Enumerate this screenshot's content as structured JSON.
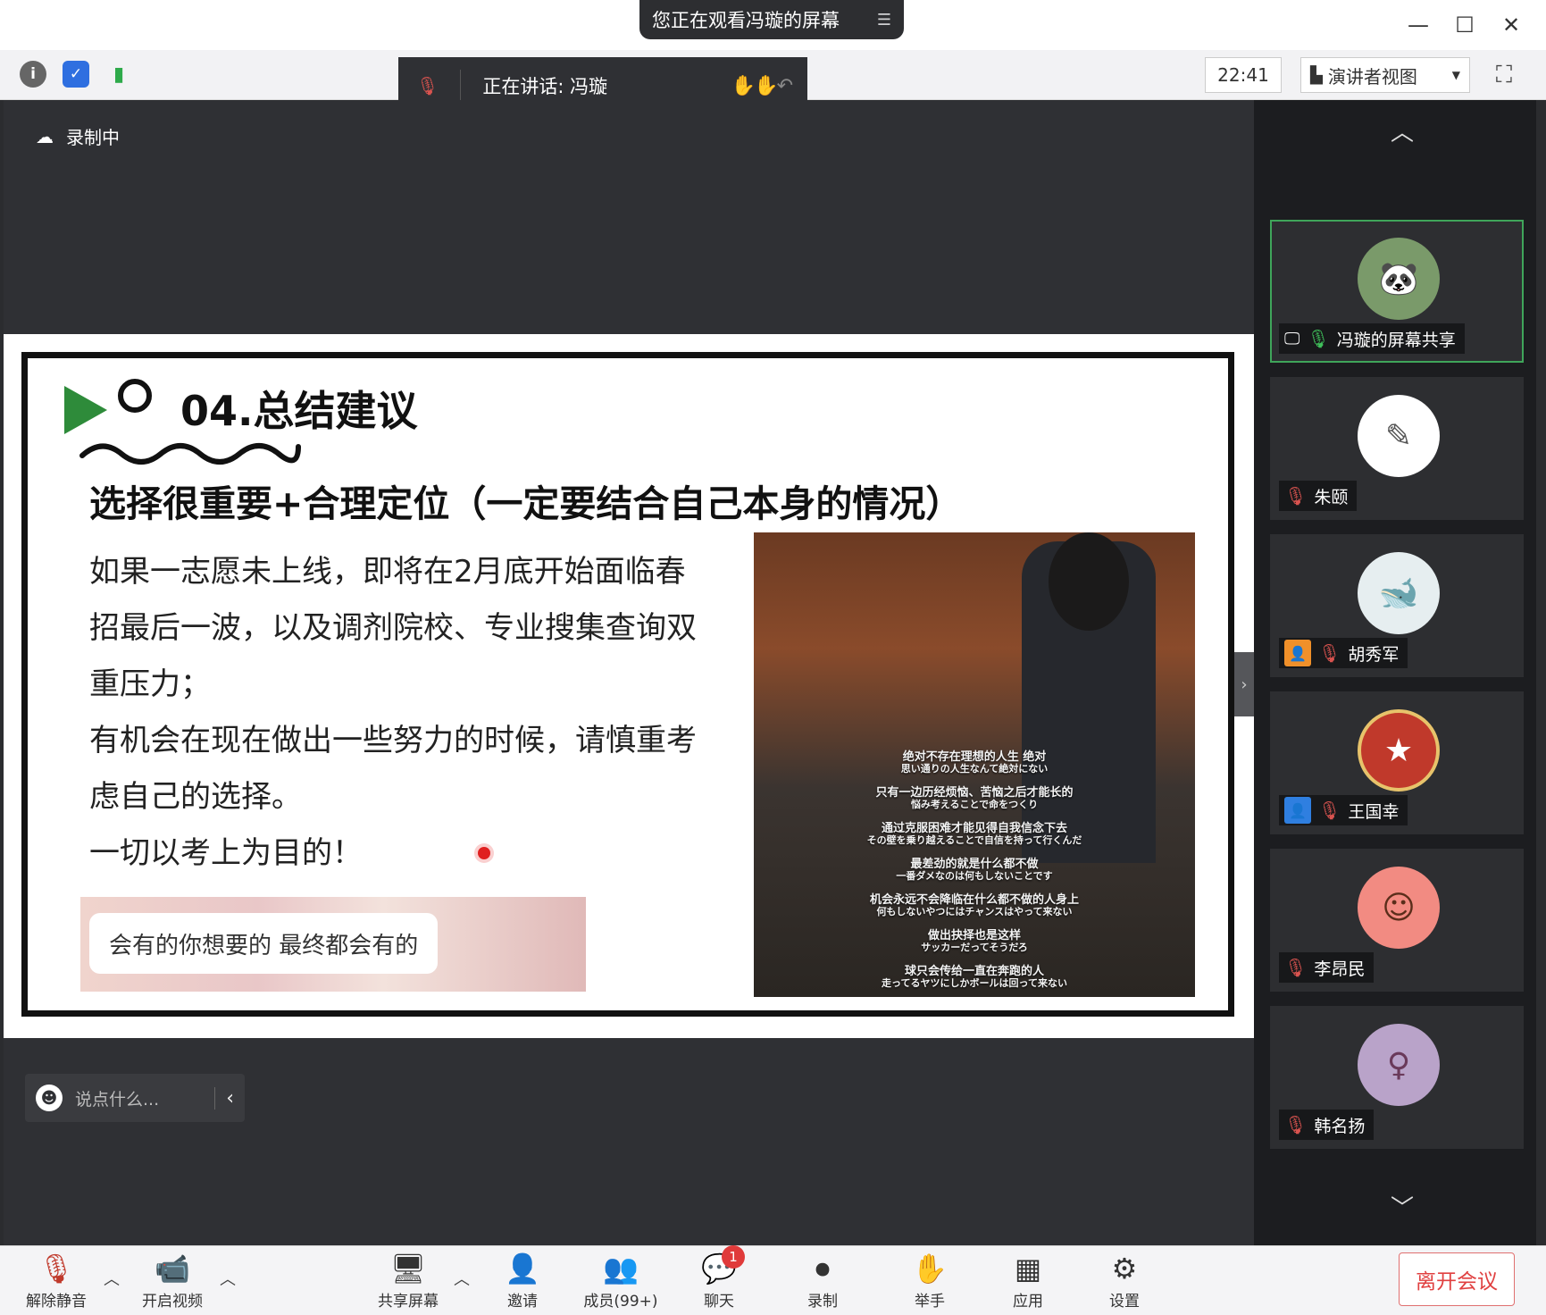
{
  "window": {
    "banner": "您正在观看冯璇的屏幕",
    "banner_icon": "menu-icon",
    "controls": [
      "minimize-icon",
      "maximize-icon",
      "close-icon"
    ]
  },
  "toolbar": {
    "speaking": "正在讲话: 冯璇",
    "clock": "22:41",
    "view": "演讲者视图",
    "icons": [
      "info-icon",
      "shield-icon",
      "signal-icon",
      "fullscreen-icon"
    ]
  },
  "stage": {
    "recording": "录制中",
    "chat_placeholder": "说点什么..."
  },
  "slide": {
    "title": "04.总结建议",
    "subtitle": "选择很重要+合理定位（一定要结合自己本身的情况）",
    "paragraphs": [
      "如果一志愿未上线，即将在2月底开始面临春",
      "招最后一波，以及调剂院校、专业搜集查询双",
      "重压力；",
      "有机会在现在做出一些努力的时候，请慎重考",
      "虑自己的选择。",
      "一切以考上为目的！"
    ],
    "quote": "会有的你想要的 最终都会有的",
    "photo_subtitles": [
      "绝对不存在理想的人生 绝对",
      "思い通りの人生なんて絶対にない",
      "只有一边历经烦恼、苦恼之后才能长的",
      "悩み考えることで命をつくり",
      "通过克服困难才能见得自我信念下去",
      "その壁を乗り越えることで自信を持って行くんだ",
      "最差劲的就是什么都不做",
      "一番ダメなのは何もしないことです",
      "机会永远不会降临在什么都不做的人身上",
      "何もしないやつにはチャンスはやって来ない",
      "做出抉择也是这样",
      "サッカーだってそうだろ",
      "球只会传给一直在奔跑的人",
      "走ってるヤツにしかボールは回って来ない"
    ]
  },
  "participants": [
    {
      "name": "冯璇的屏幕共享",
      "mic": "on",
      "active": true,
      "avatar": "panda-avatar",
      "color": "#7a9a6a"
    },
    {
      "name": "朱颐",
      "mic": "off",
      "active": false,
      "avatar": "sketch-avatar",
      "color": "#ffffff"
    },
    {
      "name": "胡秀军",
      "mic": "off",
      "active": false,
      "avatar": "whale-avatar",
      "color": "#e6eef0"
    },
    {
      "name": "王国幸",
      "mic": "off",
      "active": false,
      "avatar": "badge-avatar",
      "color": "#c0392b"
    },
    {
      "name": "李昂民",
      "mic": "off",
      "active": false,
      "avatar": "cartoon-avatar",
      "color": "#f28b82"
    },
    {
      "name": "韩名扬",
      "mic": "off",
      "active": false,
      "avatar": "anime-avatar",
      "color": "#b9a3c9"
    }
  ],
  "bottom": {
    "unmute": "解除静音",
    "video": "开启视频",
    "share": "共享屏幕",
    "invite": "邀请",
    "members": "成员(99+)",
    "chat": "聊天",
    "chat_badge": "1",
    "record": "录制",
    "raise_hand": "举手",
    "apps": "应用",
    "settings": "设置",
    "leave": "离开会议"
  }
}
